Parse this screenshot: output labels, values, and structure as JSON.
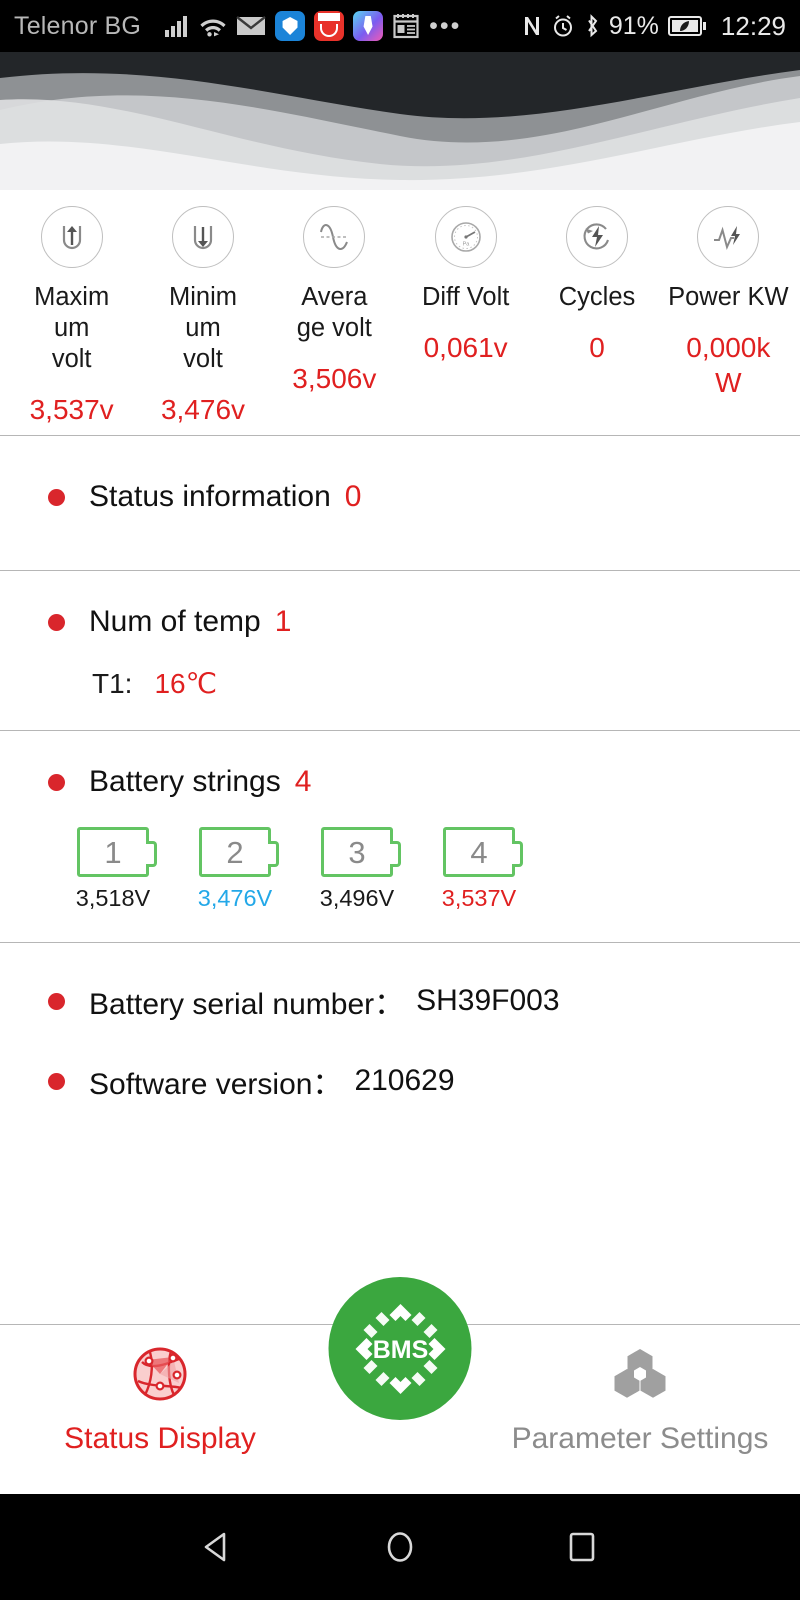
{
  "statusbar": {
    "carrier": "Telenor BG",
    "icons": [
      "signal-icon",
      "wifi-icon",
      "email-icon",
      "shield-app-icon",
      "aliexpress-app-icon",
      "paint-app-icon",
      "notes-app-icon",
      "more-icon"
    ],
    "nfc": "N",
    "alarm": "alarm-icon",
    "bluetooth": "bluetooth-icon",
    "battery_pct": "91%",
    "battery": "battery-icon",
    "time": "12:29"
  },
  "metrics": [
    {
      "icon": "voltage-up-icon",
      "label": "Maximum volt",
      "value": "3,537v"
    },
    {
      "icon": "voltage-down-icon",
      "label": "Minimum volt",
      "value": "3,476v"
    },
    {
      "icon": "sine-wave-icon",
      "label": "Average volt",
      "value": "3,506v"
    },
    {
      "icon": "gauge-icon",
      "label": "Diff Volt",
      "value": "0,061v"
    },
    {
      "icon": "cycle-bolt-icon",
      "label": "Cycles",
      "value": "0"
    },
    {
      "icon": "pulse-bolt-icon",
      "label": "Power KW",
      "value": "0,000kW"
    }
  ],
  "status_section": {
    "label": "Status information",
    "value": "0"
  },
  "temp_section": {
    "label": "Num of temp",
    "value": "1",
    "sensor_label": "T1:",
    "sensor_value": "16℃"
  },
  "battery_section": {
    "label": "Battery strings",
    "value": "4",
    "cells": [
      {
        "num": "1",
        "volt": "3,518V",
        "state": "normal"
      },
      {
        "num": "2",
        "volt": "3,476V",
        "state": "min"
      },
      {
        "num": "3",
        "volt": "3,496V",
        "state": "normal"
      },
      {
        "num": "4",
        "volt": "3,537V",
        "state": "max"
      }
    ]
  },
  "info_section": {
    "serial_label": "Battery serial number：",
    "serial_value": "SH39F003",
    "version_label": "Software version：",
    "version_value": "210629"
  },
  "bottomnav": {
    "tab_status": "Status Display",
    "tab_params": "Parameter Settings",
    "fab_label": "BMS"
  },
  "androidnav": {
    "back": "back-icon",
    "home": "home-icon",
    "recents": "recents-icon"
  },
  "colors": {
    "red": "#e02020",
    "bullet_red": "#d9262c",
    "green": "#3ba73f",
    "cell_green": "#63c463",
    "blue": "#23a8e8",
    "gray": "#8c8c8c"
  }
}
